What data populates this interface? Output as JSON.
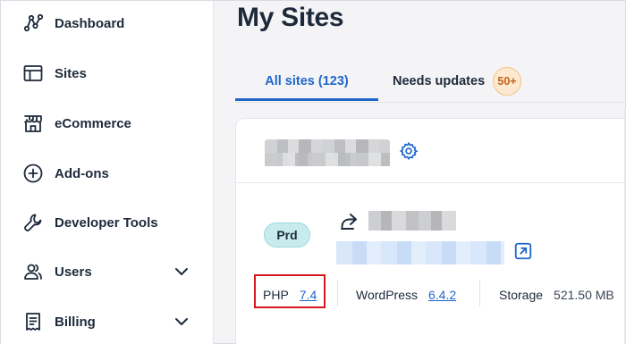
{
  "sidebar": {
    "items": [
      {
        "label": "Dashboard",
        "icon": "dashboard-icon",
        "has_chevron": false
      },
      {
        "label": "Sites",
        "icon": "sites-icon",
        "has_chevron": false
      },
      {
        "label": "eCommerce",
        "icon": "store-icon",
        "has_chevron": false
      },
      {
        "label": "Add-ons",
        "icon": "plus-circle-icon",
        "has_chevron": false
      },
      {
        "label": "Developer Tools",
        "icon": "wrench-icon",
        "has_chevron": false
      },
      {
        "label": "Users",
        "icon": "users-icon",
        "has_chevron": true
      },
      {
        "label": "Billing",
        "icon": "billing-icon",
        "has_chevron": true
      }
    ]
  },
  "main": {
    "title": "My Sites",
    "tabs": [
      {
        "label": "All sites (123)",
        "active": true
      },
      {
        "label": "Needs updates",
        "active": false,
        "badge": "50+"
      }
    ],
    "site_card": {
      "environment_badge": "Prd",
      "php": {
        "label": "PHP",
        "version": "7.4"
      },
      "wordpress": {
        "label": "WordPress",
        "version": "6.4.2"
      },
      "storage": {
        "label": "Storage",
        "value": "521.50 MB"
      }
    }
  },
  "colors": {
    "accent": "#1f66c9",
    "text": "#1e2a3b",
    "badge_bg": "#fde9cf",
    "badge_text": "#c0631a",
    "env_badge_bg": "#c8ecee",
    "highlight": "#d8171d"
  }
}
